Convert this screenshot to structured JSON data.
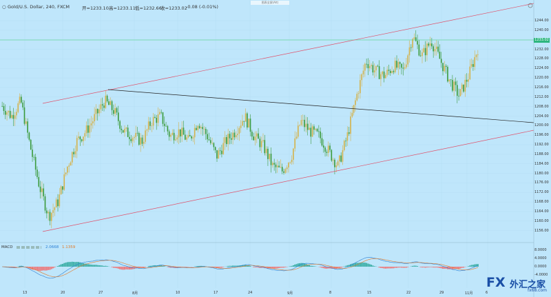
{
  "header": {
    "symbol": "Gold/U.S. Dollar, 240, FXCM",
    "open": "开=1233.10",
    "high": "高=1233.11",
    "low": "低=1232.66",
    "close": "收=1233.02",
    "change": "-0.08 (-0.01%)",
    "tooltip": "图表全屏(Alt)"
  },
  "price_axis": {
    "labels": [
      "1244.00",
      "1240.00",
      "1236.00",
      "1232.00",
      "1228.00",
      "1224.00",
      "1220.00",
      "1216.00",
      "1212.00",
      "1208.00",
      "1204.00",
      "1200.00",
      "1196.00",
      "1192.00",
      "1188.00",
      "1184.00",
      "1180.00",
      "1176.00",
      "1172.00",
      "1168.00",
      "1164.00",
      "1160.00",
      "1156.00"
    ],
    "current_price": "1233.02"
  },
  "macd_axis": {
    "labels": [
      "8.0000",
      "4.0000",
      "0.0000",
      "-4.0000"
    ]
  },
  "time_axis": {
    "labels": [
      "13",
      "20",
      "27",
      "8月",
      "10",
      "17",
      "24",
      "9月",
      "8",
      "15",
      "22",
      "29",
      "11月",
      "6"
    ]
  },
  "macd_header": {
    "name": "MACD",
    "value1": "2.0668",
    "value2": "1.1359"
  },
  "chart_data": {
    "type": "candlestick",
    "symbol": "Gold/U.S. Dollar",
    "timeframe": "240",
    "ylim": [
      1156,
      1246
    ],
    "current_price": 1233.02,
    "approx_closes": [
      1210,
      1206,
      1212,
      1194,
      1178,
      1166,
      1172,
      1186,
      1196,
      1200,
      1206,
      1212,
      1208,
      1200,
      1198,
      1196,
      1204,
      1206,
      1198,
      1200,
      1196,
      1204,
      1198,
      1190,
      1196,
      1200,
      1206,
      1198,
      1194,
      1186,
      1184,
      1190,
      1204,
      1200,
      1198,
      1192,
      1186,
      1198,
      1214,
      1228,
      1224,
      1222,
      1226,
      1224,
      1238,
      1230,
      1236,
      1228,
      1220,
      1214,
      1222,
      1233
    ]
  },
  "logo": {
    "brand": "FX",
    "cn": "外汇之家",
    "domain": "fx68.com"
  }
}
